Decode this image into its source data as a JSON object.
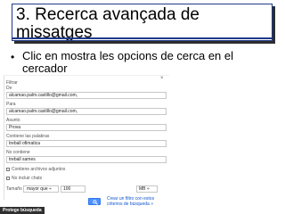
{
  "slide": {
    "title": "3. Recerca avançada de missatges",
    "bullet": "Clic en mostra les opcions de cerca en el cercador"
  },
  "filter": {
    "close_glyph": "×",
    "heading": "Filtrar",
    "from_label": "De",
    "from_value": "alcamao.palm.castillo@gmail.com,",
    "to_label": "Para",
    "to_value": "alcamao.palm.castillo@gmail.com,",
    "subject_label": "Asunto",
    "subject_value": "Prova",
    "has_words_label": "Contiene las palabras",
    "has_words_value": "treball ofimatica",
    "not_has_label": "No contiene",
    "not_has_value": "treball sames",
    "attachment_label": "Contiene archivos adjuntos",
    "chats_label": "No incluir chats",
    "size_label": "Tamaño",
    "size_operator": "mayor que",
    "size_value": "100",
    "size_unit": "MB",
    "create_filter_link": "Crear un filtro con estos criterios de búsqueda »"
  },
  "footer": {
    "corner_tag": "Protege búsqueda"
  }
}
